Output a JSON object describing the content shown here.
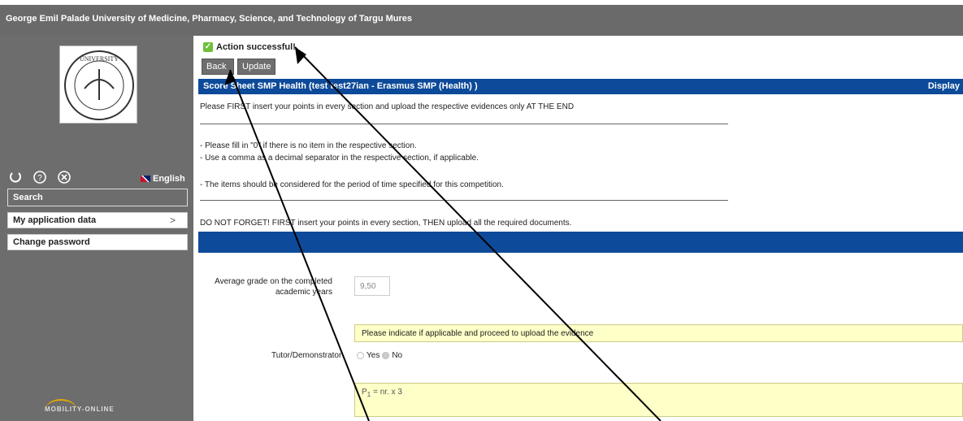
{
  "header": {
    "title": "George Emil Palade University of Medicine, Pharmacy, Science, and Technology of Targu Mures"
  },
  "sidebar": {
    "logo_text": "UNIVERSITY",
    "language": "English",
    "items": [
      {
        "label": "Search"
      },
      {
        "label": "My application data"
      },
      {
        "label": "Change password"
      }
    ],
    "brand": "MOBILITY-ONLINE"
  },
  "main": {
    "status": "Action successful!",
    "back_label": "Back",
    "update_label": "Update",
    "section_title": "Score Sheet SMP Health (test test27ian - Erasmus SMP (Health) )",
    "display_label": "Display",
    "instruction_1": "Please FIRST insert your points in every section and upload the respective evidences only AT THE END",
    "instruction_2": "- Please fill in \"0\" if there is no item in the respective section.",
    "instruction_3": "- Use a comma as a decimal separator in the respective section, if applicable.",
    "instruction_4": "- The items should be considered for the period of time specified for this competition.",
    "instruction_5": "DO NOT FORGET! FIRST insert your points in every section, THEN upload all the required documents.",
    "grade_label": "Average grade on the completed academic years",
    "grade_value": "9,50",
    "yellow_note": "Please indicate if applicable and proceed to upload the evidence",
    "tutor_label": "Tutor/Demonstrator",
    "yes_label": "Yes",
    "no_label": "No",
    "formula_prefix": "P",
    "formula_sub": "1",
    "formula_rest": " = nr. x 3"
  }
}
